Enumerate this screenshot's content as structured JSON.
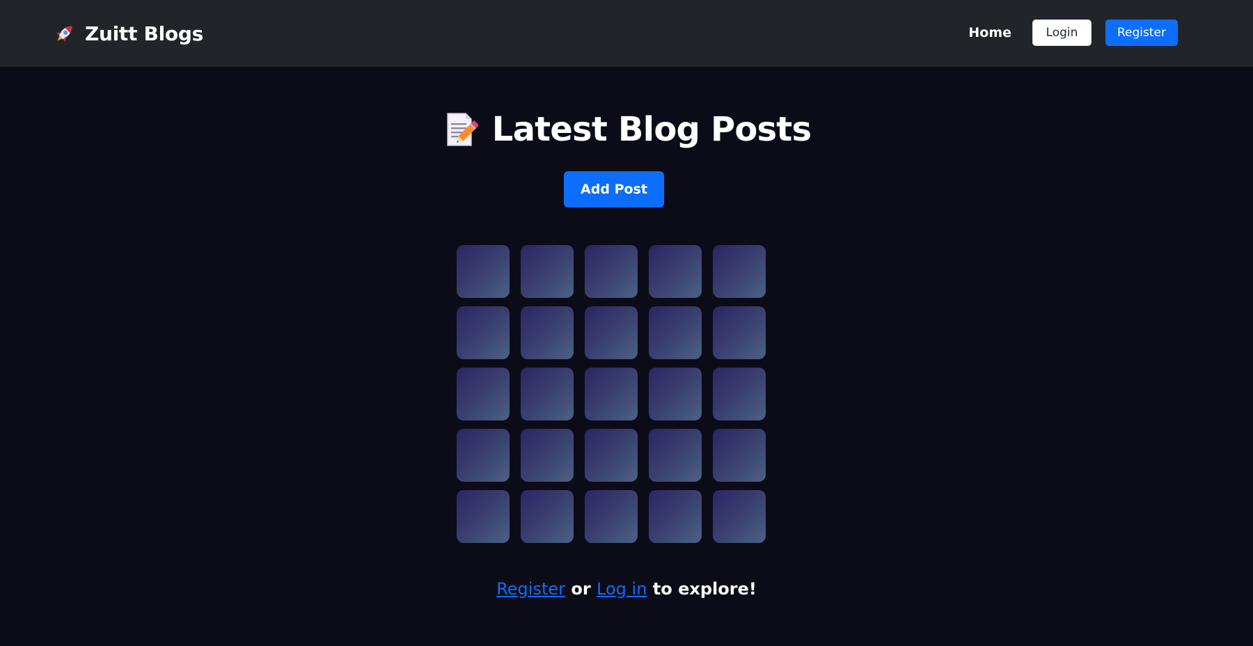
{
  "brand": {
    "icon": "rocket-icon",
    "name": "Zuitt Blogs"
  },
  "nav": {
    "home_label": "Home",
    "login_label": "Login",
    "register_label": "Register"
  },
  "page": {
    "title_icon": "memo-icon",
    "title": "Latest Blog Posts",
    "add_post_label": "Add Post"
  },
  "post_grid": {
    "rows": 5,
    "columns": 5
  },
  "footer_prompt": {
    "register_link": "Register",
    "or_text": " or ",
    "login_link": "Log in",
    "suffix_text": " to explore!"
  },
  "colors": {
    "background": "#0b0c18",
    "navbar": "#212529",
    "primary": "#0d6efd",
    "tile_gradient_start": "#2d2566",
    "tile_gradient_end": "#4a6283"
  }
}
